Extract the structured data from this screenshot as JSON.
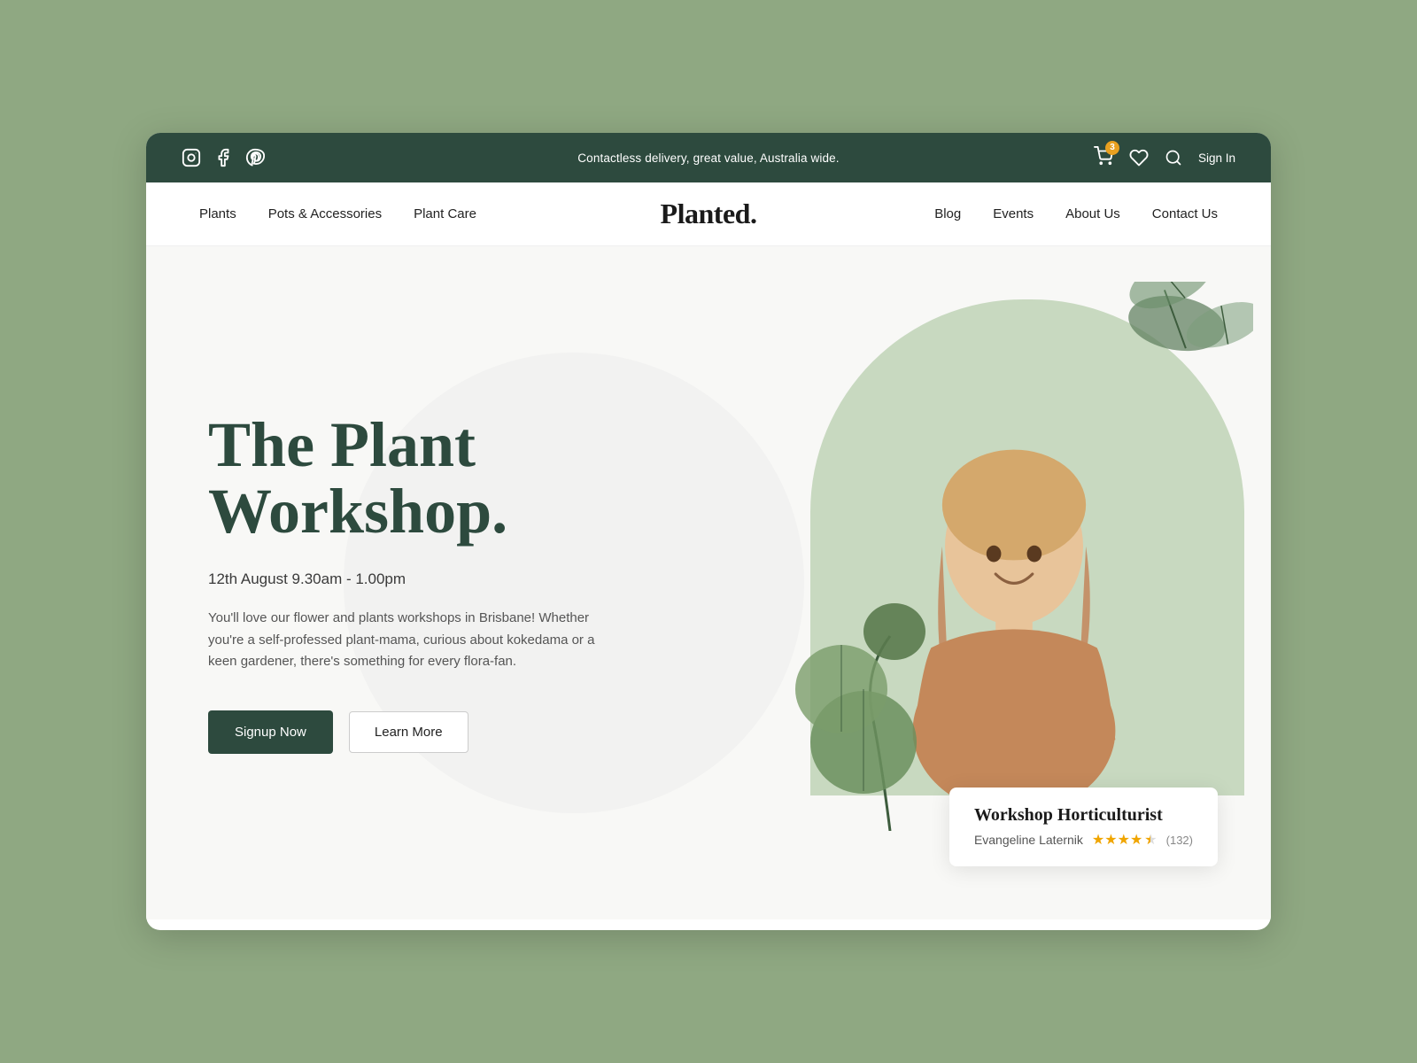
{
  "topbar": {
    "message": "Contactless delivery, great value, Australia wide.",
    "cart_count": "3",
    "sign_in": "Sign In",
    "social": [
      "instagram",
      "facebook",
      "pinterest"
    ]
  },
  "nav": {
    "logo": "Planted.",
    "left_links": [
      "Plants",
      "Pots & Accessories",
      "Plant Care"
    ],
    "right_links": [
      "Blog",
      "Events",
      "About Us",
      "Contact Us"
    ]
  },
  "hero": {
    "title": "The Plant Workshop.",
    "date": "12th August 9.30am - 1.00pm",
    "description": "You'll love our flower and plants workshops in Brisbane! Whether you're a self-professed plant-mama, curious about kokedama or a keen gardener, there's something for every flora-fan.",
    "btn_signup": "Signup Now",
    "btn_learn": "Learn More"
  },
  "card": {
    "title": "Workshop Horticulturist",
    "name": "Evangeline Laternik",
    "stars": 4.5,
    "review_count": "(132)"
  }
}
